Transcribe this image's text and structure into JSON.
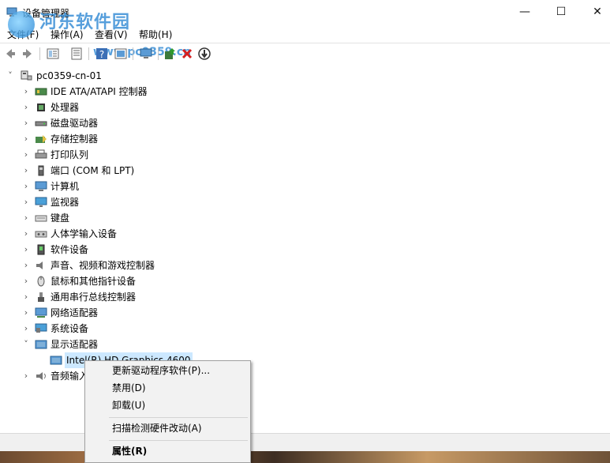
{
  "window": {
    "title": "设备管理器",
    "controls": {
      "minimize": "—",
      "maximize": "☐",
      "close": "✕"
    }
  },
  "watermark": {
    "brand": "河东软件园",
    "url": "www.pc0359.cn"
  },
  "menu": [
    {
      "label": "文件(F)"
    },
    {
      "label": "操作(A)"
    },
    {
      "label": "查看(V)"
    },
    {
      "label": "帮助(H)"
    }
  ],
  "toolbar": {
    "icons": [
      "back-arrow-icon",
      "forward-arrow-icon",
      "properties-icon",
      "list-view-icon",
      "help-icon",
      "device-view-icon",
      "monitor-scan-icon",
      "update-driver-icon",
      "uninstall-icon",
      "disable-icon"
    ]
  },
  "tree": {
    "root": "pc0359-cn-01",
    "categories": [
      {
        "label": "IDE ATA/ATAPI 控制器",
        "icon": "ide-controller-icon"
      },
      {
        "label": "处理器",
        "icon": "processor-icon"
      },
      {
        "label": "磁盘驱动器",
        "icon": "disk-drive-icon"
      },
      {
        "label": "存储控制器",
        "icon": "storage-controller-icon"
      },
      {
        "label": "打印队列",
        "icon": "printer-icon"
      },
      {
        "label": "端口 (COM 和 LPT)",
        "icon": "port-icon"
      },
      {
        "label": "计算机",
        "icon": "computer-icon"
      },
      {
        "label": "监视器",
        "icon": "monitor-icon"
      },
      {
        "label": "键盘",
        "icon": "keyboard-icon"
      },
      {
        "label": "人体学输入设备",
        "icon": "hid-icon"
      },
      {
        "label": "软件设备",
        "icon": "software-device-icon"
      },
      {
        "label": "声音、视频和游戏控制器",
        "icon": "sound-icon"
      },
      {
        "label": "鼠标和其他指针设备",
        "icon": "mouse-icon"
      },
      {
        "label": "通用串行总线控制器",
        "icon": "usb-icon"
      },
      {
        "label": "网络适配器",
        "icon": "network-adapter-icon"
      },
      {
        "label": "系统设备",
        "icon": "system-device-icon"
      },
      {
        "label": "显示适配器",
        "icon": "display-adapter-icon"
      },
      {
        "label": "音频输入和输出",
        "icon": "audio-io-icon"
      }
    ],
    "expanded_child": "Intel(R) HD Graphics 4600"
  },
  "context_menu": {
    "items": [
      {
        "label": "更新驱动程序软件(P)...",
        "bold": false
      },
      {
        "label": "禁用(D)",
        "bold": false
      },
      {
        "label": "卸载(U)",
        "bold": false
      },
      {
        "label": "扫描检测硬件改动(A)",
        "bold": false
      },
      {
        "label": "属性(R)",
        "bold": true
      }
    ]
  },
  "colors": {
    "selection": "#cce8ff",
    "accent": "#0078d7"
  }
}
